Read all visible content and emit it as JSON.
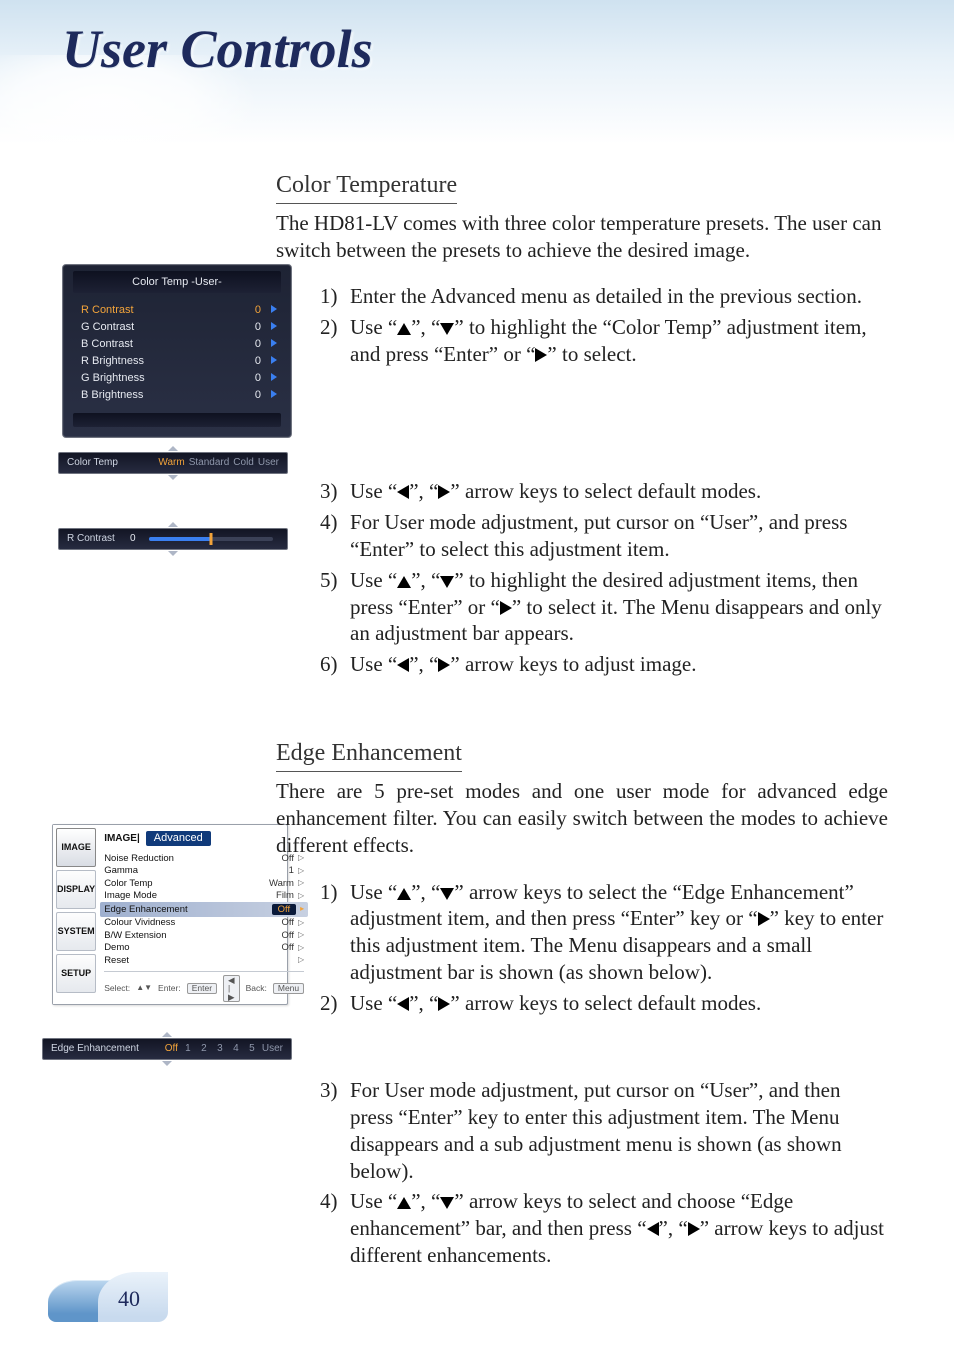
{
  "page_title": "User Controls",
  "page_number": "40",
  "section_color_temp": {
    "heading": "Color Temperature",
    "intro": "The HD81-LV comes with three color temperature presets. The user can switch between the presets to achieve the desired image.",
    "steps_a": [
      "Enter the Advanced menu as detailed in the previous section.",
      "Use “▲”, “▼” to highlight the “Color Temp” adjustment item, and press “Enter” or “▶” to select."
    ],
    "steps_b": [
      "Use “◀”, “▶” arrow keys to select default modes.",
      "For User mode adjustment, put cursor on “User”, and press “Enter” to select this adjustment item.",
      "Use “▲”, “▼” to highlight the desired adjustment items, then press “Enter” or “▶” to select it. The Menu disappears and only an adjustment bar appears.",
      "Use “◀”, “▶” arrow keys to adjust image."
    ]
  },
  "osd_color_temp_user": {
    "title": "Color Temp  -User-",
    "rows": [
      {
        "label": "R Contrast",
        "value": "0",
        "selected": true
      },
      {
        "label": "G Contrast",
        "value": "0",
        "selected": false
      },
      {
        "label": "B Contrast",
        "value": "0",
        "selected": false
      },
      {
        "label": "R Brightness",
        "value": "0",
        "selected": false
      },
      {
        "label": "G Brightness",
        "value": "0",
        "selected": false
      },
      {
        "label": "B Brightness",
        "value": "0",
        "selected": false
      }
    ]
  },
  "selector_color_temp": {
    "label": "Color Temp",
    "options": [
      "Warm",
      "Standard",
      "Cold",
      "User"
    ],
    "selected_index": 0
  },
  "slider_r_contrast": {
    "label": "R Contrast",
    "value": "0"
  },
  "section_edge": {
    "heading": "Edge Enhancement",
    "intro": "There are 5 pre-set modes and one user mode for advanced edge enhancement filter. You can easily switch between the modes to achieve different effects.",
    "steps_a": [
      "Use “▲”, “▼” arrow keys to select the “Edge Enhancement” adjustment item, and then press “Enter” key or “▶” key to enter this adjustment item. The Menu disappears and a small adjustment bar is shown (as shown below).",
      "Use “◀”, “▶” arrow keys to select default modes."
    ],
    "steps_b": [
      "For User mode adjustment, put cursor on “User”, and then press “Enter” key to enter this adjustment item. The Menu disappears and a sub adjustment menu is shown (as shown below).",
      "Use “▲”, “▼” arrow keys to select and choose “Edge enhancement” bar, and then press “◀”, “▶” arrow keys to adjust different enhancements."
    ]
  },
  "osd_advanced": {
    "crumb1": "IMAGE|",
    "crumb2": "Advanced",
    "tabs": [
      "IMAGE",
      "DISPLAY",
      "SYSTEM",
      "SETUP"
    ],
    "active_tab": 0,
    "rows": [
      {
        "label": "Noise Reduction",
        "value": "Off",
        "selected": false
      },
      {
        "label": "Gamma",
        "value": "1",
        "selected": false
      },
      {
        "label": "Color Temp",
        "value": "Warm",
        "selected": false
      },
      {
        "label": "Image Mode",
        "value": "Film",
        "selected": false
      },
      {
        "label": "Edge Enhancement",
        "value": "Off",
        "selected": true
      },
      {
        "label": "Colour Vividness",
        "value": "Off",
        "selected": false
      },
      {
        "label": "B/W Extension",
        "value": "Off",
        "selected": false
      },
      {
        "label": "Demo",
        "value": "Off",
        "selected": false
      },
      {
        "label": "Reset",
        "value": "",
        "selected": false
      }
    ],
    "hints": {
      "select": "Select:",
      "enter": "Enter:",
      "enter_btn": "Enter",
      "nav_btn": "◀ | ▶",
      "back": "Back:",
      "back_btn": "Menu"
    }
  },
  "selector_edge": {
    "label": "Edge Enhancement",
    "options": [
      "Off",
      "1",
      "2",
      "3",
      "4",
      "5",
      "User"
    ],
    "selected_index": 0
  }
}
